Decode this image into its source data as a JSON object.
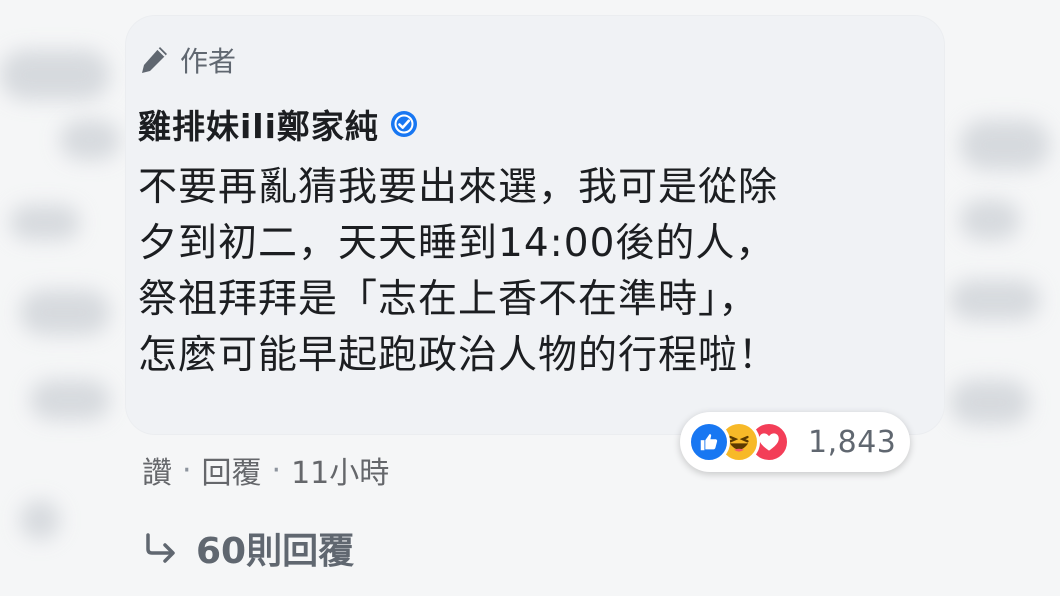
{
  "comment": {
    "author_tag": "作者",
    "author_name": "雞排妹ili鄭家純",
    "message_lines": [
      "不要再亂猜我要出來選，我可是從除",
      "夕到初二，天天睡到14:00後的人，",
      "祭祖拜拜是「志在上香不在準時」，",
      "怎麼可能早起跑政治人物的行程啦！"
    ],
    "reactions": {
      "icons": [
        "like-icon",
        "haha-icon",
        "care-icon"
      ],
      "count": "1,843"
    },
    "actions": {
      "like": "讚",
      "reply": "回覆",
      "time": "11小時"
    },
    "view_replies": "60則回覆"
  },
  "colors": {
    "bubble": "#f0f2f5",
    "text": "#1c1e21",
    "secondary": "#606770",
    "like": "#1877f2",
    "haha": "#f7b928",
    "care": "#f33e58",
    "verified": "#1877f2"
  }
}
